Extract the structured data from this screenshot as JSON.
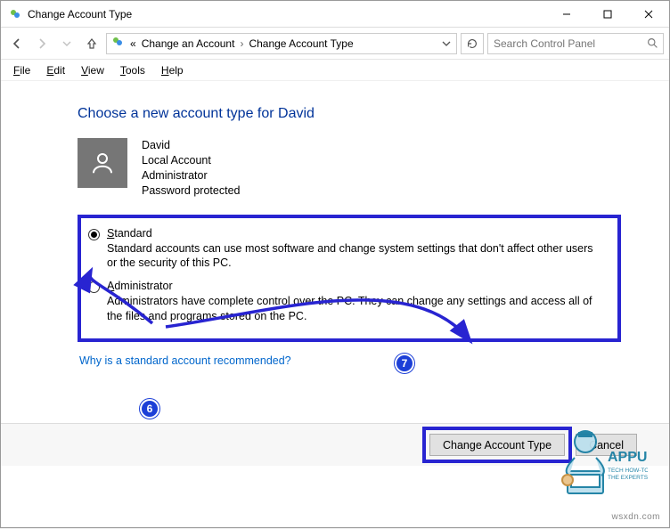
{
  "window": {
    "title": "Change Account Type"
  },
  "nav": {
    "crumb1": "Change an Account",
    "crumb2": "Change Account Type",
    "ellipsis": "«"
  },
  "search": {
    "placeholder": "Search Control Panel"
  },
  "menu": {
    "file": "File",
    "file_u": "F",
    "edit": "Edit",
    "edit_u": "E",
    "view": "View",
    "view_u": "V",
    "tools": "Tools",
    "tools_u": "T",
    "help": "Help",
    "help_u": "H"
  },
  "page": {
    "title": "Choose a new account type for David",
    "user_name": "David",
    "user_type": "Local Account",
    "user_role": "Administrator",
    "user_pw": "Password protected"
  },
  "options": {
    "standard": {
      "label_u": "S",
      "label_rest": "tandard",
      "desc": "Standard accounts can use most software and change system settings that don't affect other users or the security of this PC."
    },
    "admin": {
      "label_u": "A",
      "label_rest": "dministrator",
      "desc": "Administrators have complete control over the PC. They can change any settings and access all of the files and programs stored on the PC."
    }
  },
  "link": {
    "text": "Why is a standard account recommended?"
  },
  "buttons": {
    "change": "Change Account Type",
    "cancel": "Cancel"
  },
  "steps": {
    "six": "6",
    "seven": "7"
  },
  "watermark": "wsxdn.com",
  "logo": {
    "brand": "APPUALS",
    "tag1": "TECH HOW-TO'S FROM",
    "tag2": "THE EXPERTS"
  }
}
